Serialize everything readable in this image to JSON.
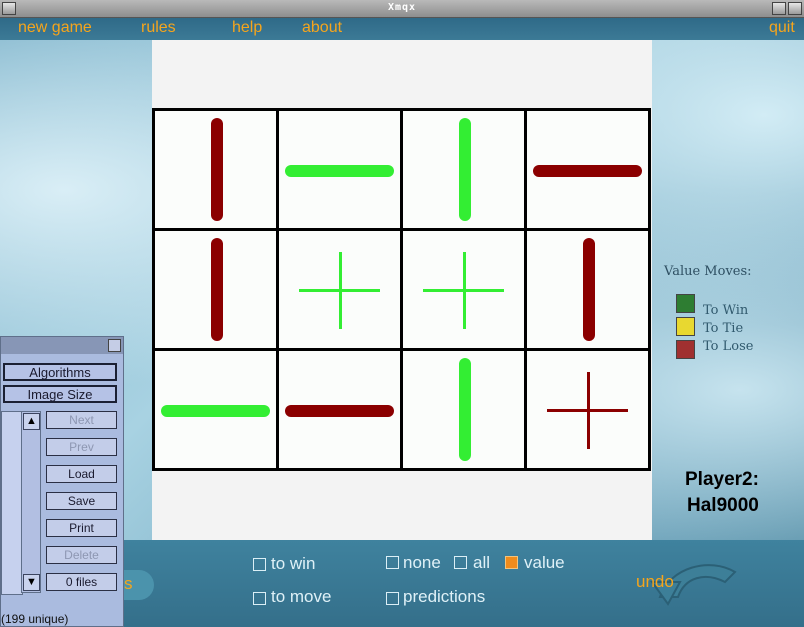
{
  "window": {
    "title": "Xmqx"
  },
  "menu": {
    "new_game": "new game",
    "rules": "rules",
    "help": "help",
    "about": "about",
    "quit": "quit"
  },
  "board": {
    "rows": 3,
    "cols": 4,
    "cells": [
      {
        "row": 0,
        "col": 0,
        "piece": "vertical",
        "value": "lose"
      },
      {
        "row": 0,
        "col": 1,
        "piece": "horizontal",
        "value": "win"
      },
      {
        "row": 0,
        "col": 2,
        "piece": "vertical",
        "value": "win"
      },
      {
        "row": 0,
        "col": 3,
        "piece": "horizontal",
        "value": "lose"
      },
      {
        "row": 1,
        "col": 0,
        "piece": "vertical",
        "value": "lose"
      },
      {
        "row": 1,
        "col": 1,
        "piece": "plus",
        "value": "win"
      },
      {
        "row": 1,
        "col": 2,
        "piece": "plus",
        "value": "win"
      },
      {
        "row": 1,
        "col": 3,
        "piece": "vertical",
        "value": "lose"
      },
      {
        "row": 2,
        "col": 0,
        "piece": "horizontal",
        "value": "win"
      },
      {
        "row": 2,
        "col": 1,
        "piece": "horizontal",
        "value": "lose"
      },
      {
        "row": 2,
        "col": 2,
        "piece": "vertical",
        "value": "win"
      },
      {
        "row": 2,
        "col": 3,
        "piece": "plus",
        "value": "lose"
      }
    ]
  },
  "colors": {
    "win": "#33ee33",
    "lose": "#8b0000",
    "legend_win": "#2e7d32",
    "legend_tie": "#e8d830",
    "legend_lose": "#a03030"
  },
  "legend": {
    "title": "Value Moves:",
    "win": "To Win",
    "tie": "To Tie",
    "lose": "To Lose"
  },
  "player": {
    "line1": "Player2:",
    "line2": "Hal9000"
  },
  "options": {
    "to_win": "to win",
    "to_move": "to move",
    "none": "none",
    "all": "all",
    "value": "value",
    "predictions": "predictions",
    "checked": {
      "to_win": false,
      "to_move": false,
      "none": false,
      "all": false,
      "value": true,
      "predictions": false
    }
  },
  "undo": "undo",
  "panel": {
    "algorithms": "Algorithms",
    "image_size": "Image Size",
    "next": "Next",
    "prev": "Prev",
    "load": "Load",
    "save": "Save",
    "print": "Print",
    "delete": "Delete",
    "files": "0 files",
    "status": "(199 unique)",
    "partial_label": "s"
  }
}
